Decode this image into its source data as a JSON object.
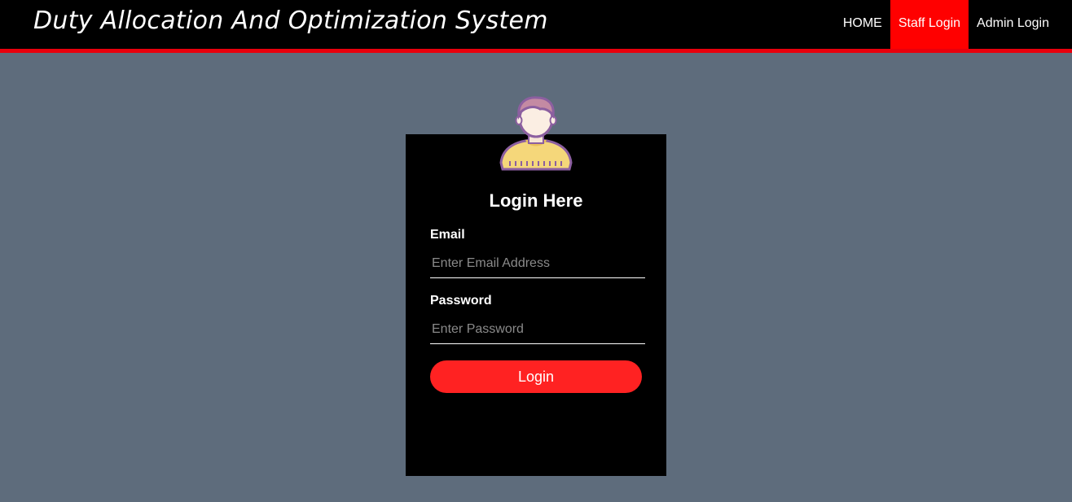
{
  "header": {
    "title": "Duty Allocation And Optimization System",
    "nav": [
      {
        "label": "HOME",
        "active": false
      },
      {
        "label": "Staff Login",
        "active": true
      },
      {
        "label": "Admin Login",
        "active": false
      }
    ]
  },
  "login": {
    "avatar_icon": "user-avatar-icon",
    "title": "Login Here",
    "email_label": "Email",
    "email_placeholder": "Enter Email Address",
    "email_value": "",
    "password_label": "Password",
    "password_placeholder": "Enter Password",
    "password_value": "",
    "button_label": "Login"
  },
  "colors": {
    "page_background": "#5e6c7c",
    "header_background": "#000000",
    "accent": "#ff0000",
    "button": "#ff2222",
    "card_background": "#000000"
  }
}
